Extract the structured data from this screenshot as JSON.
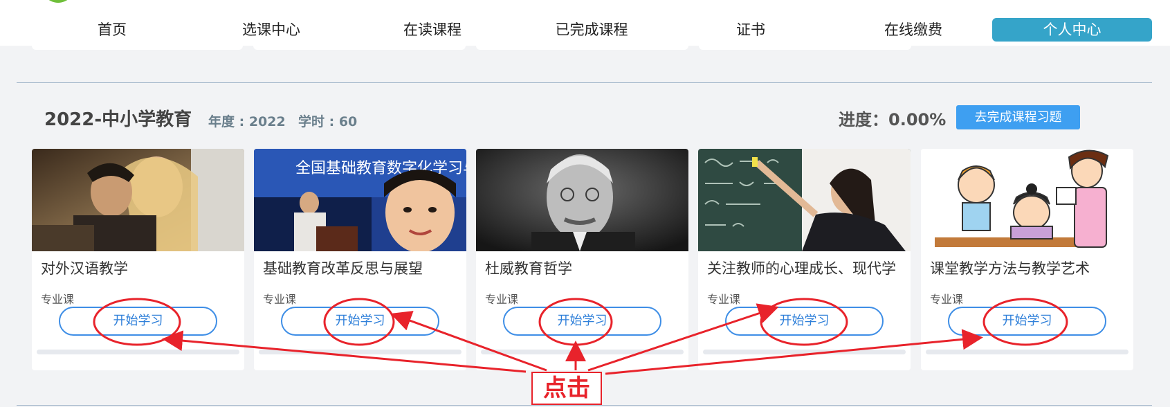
{
  "nav": {
    "items": [
      "首页",
      "选课中心",
      "在读课程",
      "已完成课程",
      "证书",
      "在线缴费",
      "个人中心"
    ],
    "active": "个人中心"
  },
  "course": {
    "title": "2022-中小学教育",
    "year": "年度 : 2022",
    "hours": "学时 : 60",
    "progress": "进度：0.00%",
    "exercise_button": "去完成课程习题"
  },
  "cards": [
    {
      "title": "对外汉语教学",
      "type": "专业课",
      "button": "开始学习",
      "progress": 0
    },
    {
      "title": "基础教育改革反思与展望",
      "type": "专业课",
      "button": "开始学习",
      "progress": 0,
      "image_text": "全国基础教育数字化学习与"
    },
    {
      "title": "杜威教育哲学",
      "type": "专业课",
      "button": "开始学习",
      "progress": 0
    },
    {
      "title": "关注教师的心理成长、现代学",
      "type": "专业课",
      "button": "开始学习",
      "progress": 0
    },
    {
      "title": "课堂教学方法与教学艺术",
      "type": "专业课",
      "button": "开始学习",
      "progress": 0
    }
  ],
  "annotation": {
    "label": "点击",
    "color": "#e8232b"
  },
  "colors": {
    "accent": "#35a4c9",
    "button_blue": "#3e9ff1",
    "outline_blue": "#3e8ee6"
  }
}
